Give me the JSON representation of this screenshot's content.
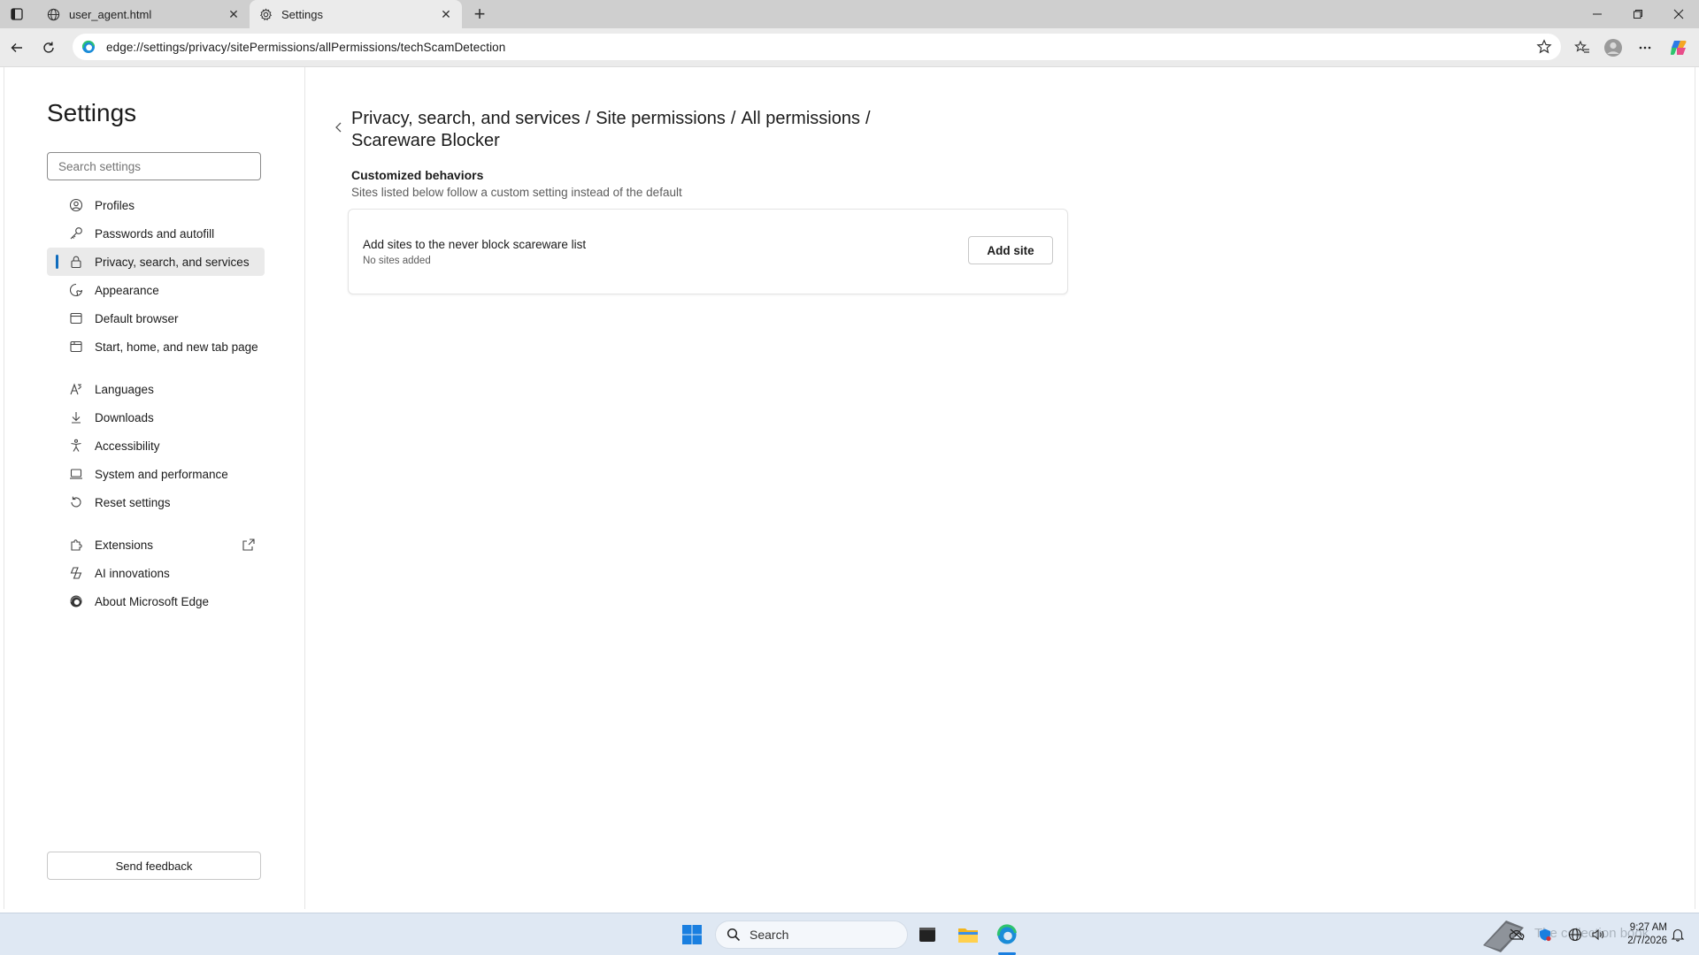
{
  "browser": {
    "tabs": [
      {
        "title": "user_agent.html",
        "icon": "globe-icon",
        "active": false
      },
      {
        "title": "Settings",
        "icon": "gear-icon",
        "active": true
      }
    ],
    "address": "edge://settings/privacy/sitePermissions/allPermissions/techScamDetection"
  },
  "sidebar": {
    "title": "Settings",
    "search_placeholder": "Search settings",
    "items": [
      {
        "label": "Profiles",
        "icon": "profile-icon"
      },
      {
        "label": "Passwords and autofill",
        "icon": "key-icon"
      },
      {
        "label": "Privacy, search, and services",
        "icon": "lock-icon",
        "selected": true
      },
      {
        "label": "Appearance",
        "icon": "appearance-icon"
      },
      {
        "label": "Default browser",
        "icon": "browser-icon"
      },
      {
        "label": "Start, home, and new tab page",
        "icon": "home-tab-icon"
      },
      {
        "label": "Languages",
        "icon": "languages-icon"
      },
      {
        "label": "Downloads",
        "icon": "download-icon"
      },
      {
        "label": "Accessibility",
        "icon": "accessibility-icon"
      },
      {
        "label": "System and performance",
        "icon": "laptop-icon"
      },
      {
        "label": "Reset settings",
        "icon": "reset-icon"
      },
      {
        "label": "Extensions",
        "icon": "extensions-icon"
      },
      {
        "label": "AI innovations",
        "icon": "ai-icon"
      },
      {
        "label": "About Microsoft Edge",
        "icon": "edge-icon"
      }
    ],
    "feedback_label": "Send feedback"
  },
  "main": {
    "breadcrumb": [
      "Privacy, search, and services",
      "Site permissions",
      "All permissions",
      "Scareware Blocker"
    ],
    "breadcrumb_separator": "/",
    "section_title": "Customized behaviors",
    "section_subtitle": "Sites listed below follow a custom setting instead of the default",
    "card": {
      "title": "Add sites to the never block scareware list",
      "subtitle": "No sites added",
      "button_label": "Add site"
    }
  },
  "taskbar": {
    "search_label": "Search",
    "tray_watermark": "The collection book",
    "time": "9:27 AM",
    "date": "2/7/2026"
  },
  "colors": {
    "accent": "#0f6cbd",
    "tabstrip": "#cfcfcf",
    "toolbar": "#ebebeb",
    "taskbar": "#dfe8f3"
  }
}
